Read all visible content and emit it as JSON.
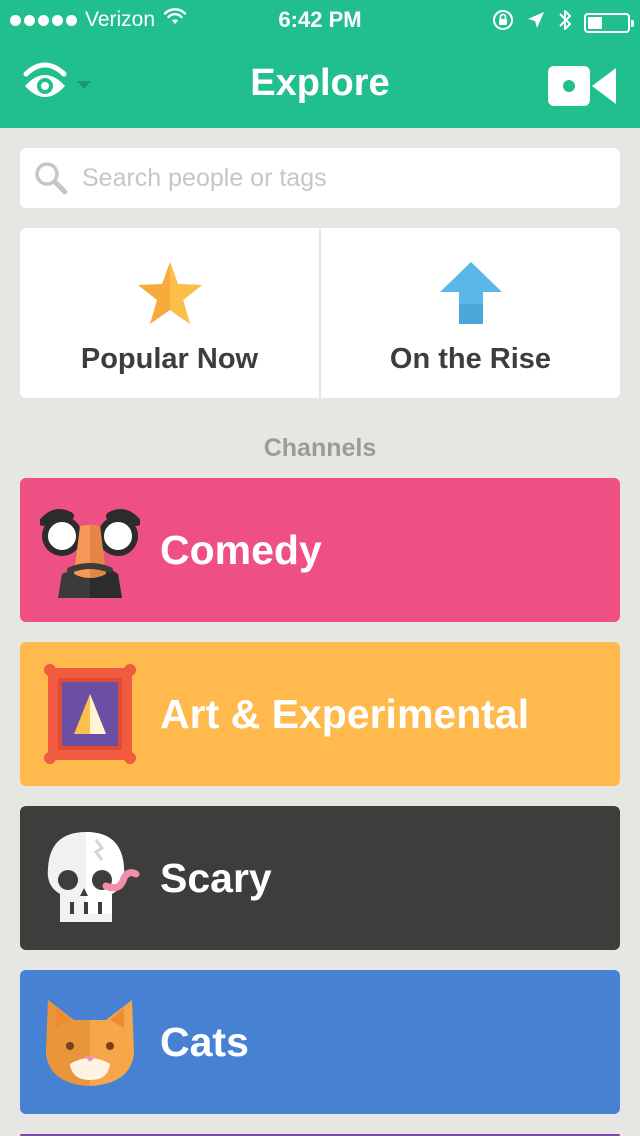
{
  "status_bar": {
    "carrier": "Verizon",
    "time": "6:42 PM"
  },
  "nav": {
    "title": "Explore"
  },
  "search": {
    "placeholder": "Search people or tags",
    "value": ""
  },
  "featured": [
    {
      "label": "Popular Now",
      "icon": "star-icon"
    },
    {
      "label": "On the Rise",
      "icon": "arrow-up-icon"
    }
  ],
  "channels_header": "Channels",
  "channels": [
    {
      "label": "Comedy",
      "icon": "groucho-glasses-icon",
      "color": "#EF5083"
    },
    {
      "label": "Art & Experimental",
      "icon": "framed-painting-icon",
      "color": "#FFB94C"
    },
    {
      "label": "Scary",
      "icon": "skull-icon",
      "color": "#3E3D3C"
    },
    {
      "label": "Cats",
      "icon": "cat-icon",
      "color": "#4681D3"
    }
  ],
  "colors": {
    "brand": "#21BF8E",
    "background": "#E6E6E3",
    "partial_next_channel": "#7B4DA8"
  }
}
